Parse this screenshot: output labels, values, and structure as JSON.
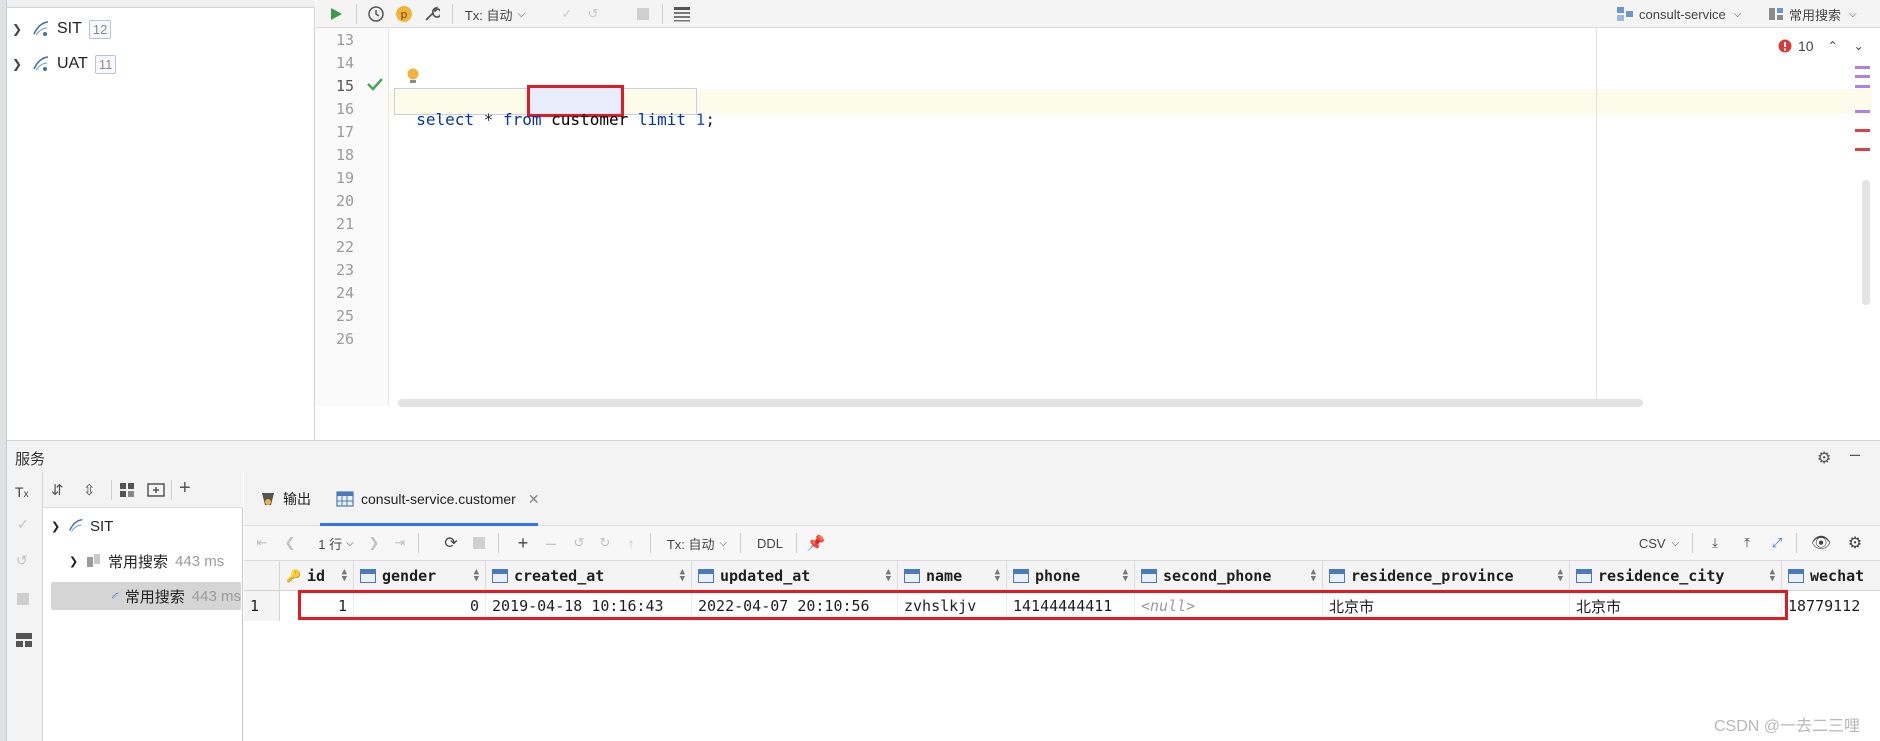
{
  "db_tree": {
    "items": [
      {
        "label": "SIT",
        "count": "12"
      },
      {
        "label": "UAT",
        "count": "11"
      }
    ]
  },
  "editor_toolbar": {
    "tx_mode": "Tx: 自动",
    "datasource": "consult-service",
    "schema": "常用搜索"
  },
  "editor": {
    "line_numbers": [
      "13",
      "14",
      "15",
      "16",
      "17",
      "18",
      "19",
      "20",
      "21",
      "22",
      "23",
      "24",
      "25",
      "26"
    ],
    "sql": {
      "select": "select",
      "star": "*",
      "from": "from",
      "table": "customer",
      "limit": "limit",
      "value": "1",
      "semicolon": ";"
    },
    "problems_count": "10"
  },
  "services": {
    "title": "服务",
    "tree": [
      {
        "label": "SIT"
      },
      {
        "label": "常用搜索",
        "time": "443 ms"
      },
      {
        "label": "常用搜索",
        "time": "443 ms"
      }
    ]
  },
  "results": {
    "tabs": [
      {
        "label": "输出"
      },
      {
        "label": "consult-service.customer"
      }
    ],
    "toolbar": {
      "rows": "1 行",
      "tx_mode": "Tx: 自动",
      "ddl": "DDL",
      "export_format": "CSV"
    },
    "columns": [
      "id",
      "gender",
      "created_at",
      "updated_at",
      "name",
      "phone",
      "second_phone",
      "residence_province",
      "residence_city",
      "wechat"
    ],
    "rows": [
      {
        "row_num": "1",
        "cells": [
          "1",
          "0",
          "2019-04-18 10:16:43",
          "2022-04-07 20:10:56",
          "zvhslkjv",
          "14144444411",
          "<null>",
          "北京市",
          "北京市",
          "18779112"
        ]
      }
    ]
  },
  "watermark": "CSDN @一去二三哩",
  "colors": {
    "highlight_red": "#e01b24",
    "keyword_blue": "#0033b3",
    "accent_blue": "#3574f0"
  }
}
